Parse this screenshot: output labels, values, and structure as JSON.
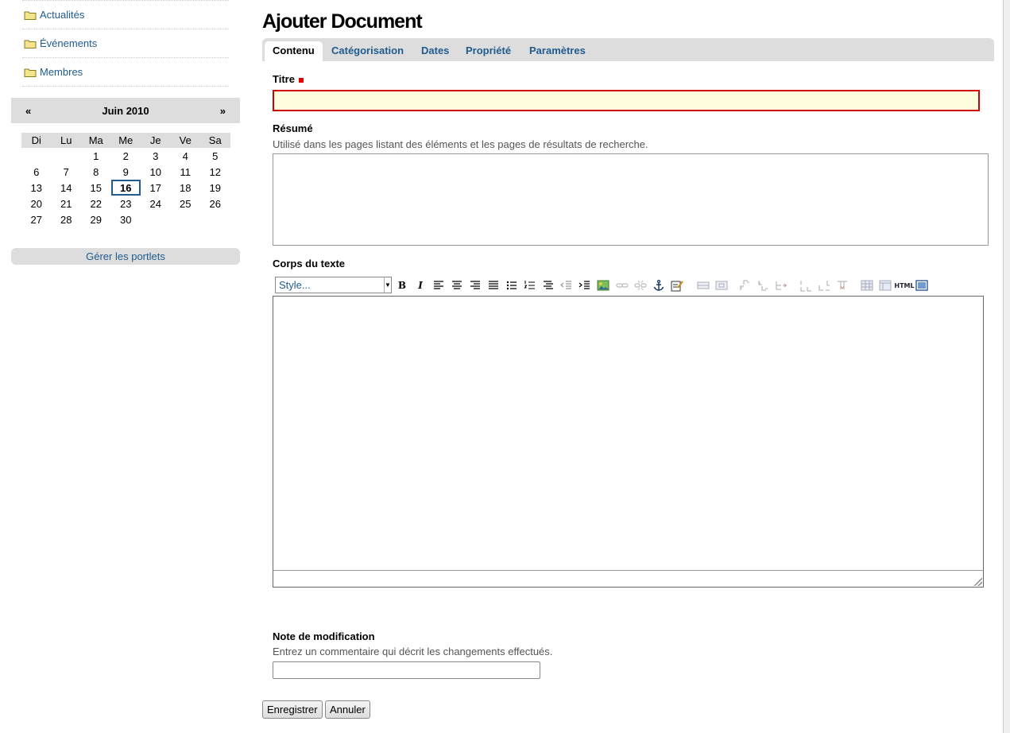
{
  "sidebar": {
    "nav": [
      {
        "label": "Actualités"
      },
      {
        "label": "Événements"
      },
      {
        "label": "Membres"
      }
    ],
    "calendar": {
      "prev": "«",
      "next": "»",
      "month": "Juin 2010",
      "weekdays": [
        "Di",
        "Lu",
        "Ma",
        "Me",
        "Je",
        "Ve",
        "Sa"
      ],
      "weeks": [
        [
          "",
          "",
          "1",
          "2",
          "3",
          "4",
          "5"
        ],
        [
          "6",
          "7",
          "8",
          "9",
          "10",
          "11",
          "12"
        ],
        [
          "13",
          "14",
          "15",
          "16",
          "17",
          "18",
          "19"
        ],
        [
          "20",
          "21",
          "22",
          "23",
          "24",
          "25",
          "26"
        ],
        [
          "27",
          "28",
          "29",
          "30",
          "",
          "",
          ""
        ]
      ],
      "today": "16"
    },
    "manage_portlets": "Gérer les portlets"
  },
  "page": {
    "title": "Ajouter Document",
    "tabs": [
      "Contenu",
      "Catégorisation",
      "Dates",
      "Propriété",
      "Paramètres"
    ],
    "active_tab": "Contenu"
  },
  "form": {
    "titre_label": "Titre",
    "titre_value": "",
    "resume_label": "Résumé",
    "resume_help": "Utilisé dans les pages listant des éléments et les pages de résultats de recherche.",
    "resume_value": "",
    "body_label": "Corps du texte",
    "style_select": "Style...",
    "html_button": "HTML",
    "note_label": "Note de modification",
    "note_help": "Entrez un commentaire qui décrit les changements effectués.",
    "note_value": "",
    "save_button": "Enregistrer",
    "cancel_button": "Annuler"
  },
  "colors": {
    "link": "#205c90",
    "required": "#dd0000",
    "tab_bar": "#dddddd",
    "titre_bg": "#ffffe0"
  }
}
